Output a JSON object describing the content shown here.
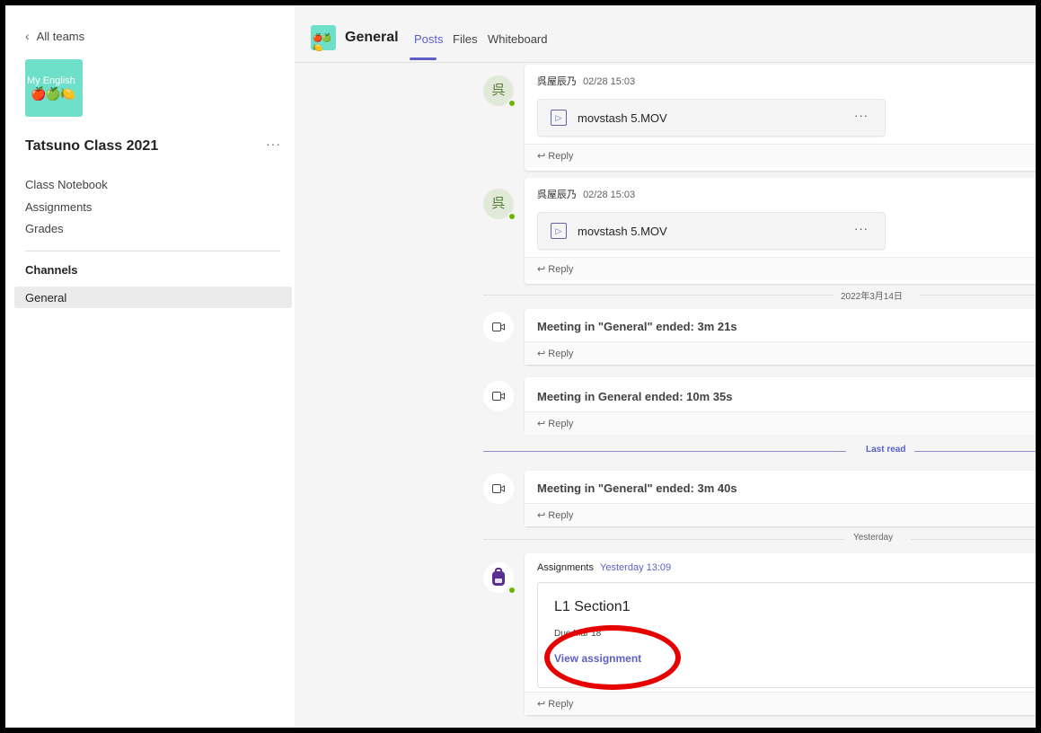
{
  "sidebar": {
    "back_label": "All teams",
    "team_logo_text": "My English",
    "team_name": "Tatsuno Class 2021",
    "team_more": "···",
    "links": [
      "Class Notebook",
      "Assignments",
      "Grades"
    ],
    "channels_heading": "Channels",
    "channels": [
      "General"
    ]
  },
  "header": {
    "channel_name": "General",
    "tabs": [
      "Posts",
      "Files",
      "Whiteboard"
    ],
    "active_tab": "Posts"
  },
  "feed": {
    "posts": [
      {
        "avatar_char": "呉",
        "author": "呉屋辰乃",
        "time": "02/28 15:03",
        "file": "movstash 5.MOV",
        "file_more": "···",
        "reply": "Reply"
      },
      {
        "avatar_char": "呉",
        "author": "呉屋辰乃",
        "time": "02/28 15:03",
        "file": "movstash 5.MOV",
        "file_more": "···",
        "reply": "Reply"
      }
    ],
    "date_sep_1": "2022年3月14日",
    "meetings": [
      {
        "text": "Meeting in \"General\" ended: 3m 21s",
        "reply": "Reply"
      },
      {
        "text": "Meeting in General ended: 10m 35s",
        "reply": "Reply"
      },
      {
        "text": "Meeting in \"General\" ended: 3m 40s",
        "reply": "Reply"
      }
    ],
    "last_read": "Last read",
    "date_sep_2": "Yesterday",
    "assignment_post": {
      "author": "Assignments",
      "time": "Yesterday 13:09",
      "title": "L1 Section1",
      "due": "Due Mar 18",
      "button": "View assignment",
      "reply": "Reply"
    }
  },
  "colors": {
    "accent": "#5b5fc7",
    "team_logo_bg": "#6ee0c9",
    "annotation_circle": "#e60000",
    "presence_green": "#6bb700",
    "assignments_purple": "#5c2e91"
  }
}
